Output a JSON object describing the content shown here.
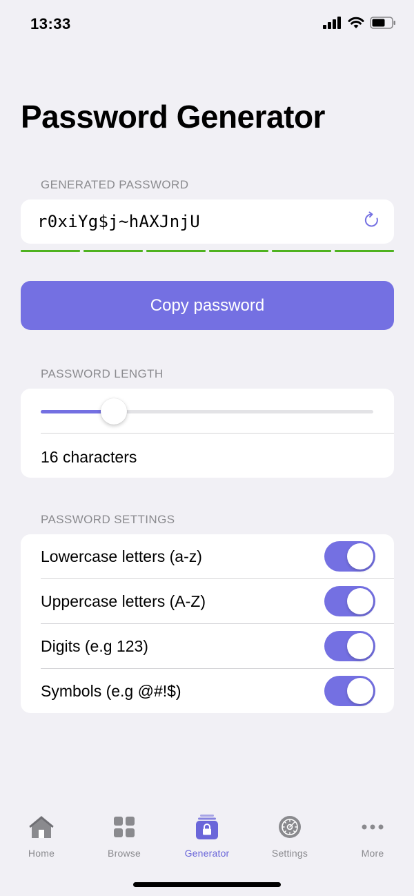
{
  "status_bar": {
    "time": "13:33"
  },
  "header": {
    "title": "Password Generator"
  },
  "generated": {
    "section_label": "GENERATED PASSWORD",
    "password": "r0xiYg$j~hAXJnjU",
    "strength_segments": 6,
    "strength_color": "#4fb220"
  },
  "copy_button": {
    "label": "Copy password"
  },
  "length": {
    "section_label": "PASSWORD LENGTH",
    "slider_fraction": 0.22,
    "value_text": "16 characters"
  },
  "settings": {
    "section_label": "PASSWORD SETTINGS",
    "items": [
      {
        "label": "Lowercase letters (a-z)",
        "enabled": true
      },
      {
        "label": "Uppercase letters (A-Z)",
        "enabled": true
      },
      {
        "label": "Digits (e.g 123)",
        "enabled": true
      },
      {
        "label": "Symbols (e.g @#!$)",
        "enabled": true
      }
    ]
  },
  "tab_bar": {
    "active_index": 2,
    "items": [
      {
        "label": "Home",
        "icon": "home-icon"
      },
      {
        "label": "Browse",
        "icon": "grid-icon"
      },
      {
        "label": "Generator",
        "icon": "lock-icon"
      },
      {
        "label": "Settings",
        "icon": "gear-icon"
      },
      {
        "label": "More",
        "icon": "ellipsis-icon"
      }
    ]
  },
  "colors": {
    "accent": "#7470e2",
    "background": "#f1f0f5",
    "inactive_tab": "#8a8a8e"
  }
}
